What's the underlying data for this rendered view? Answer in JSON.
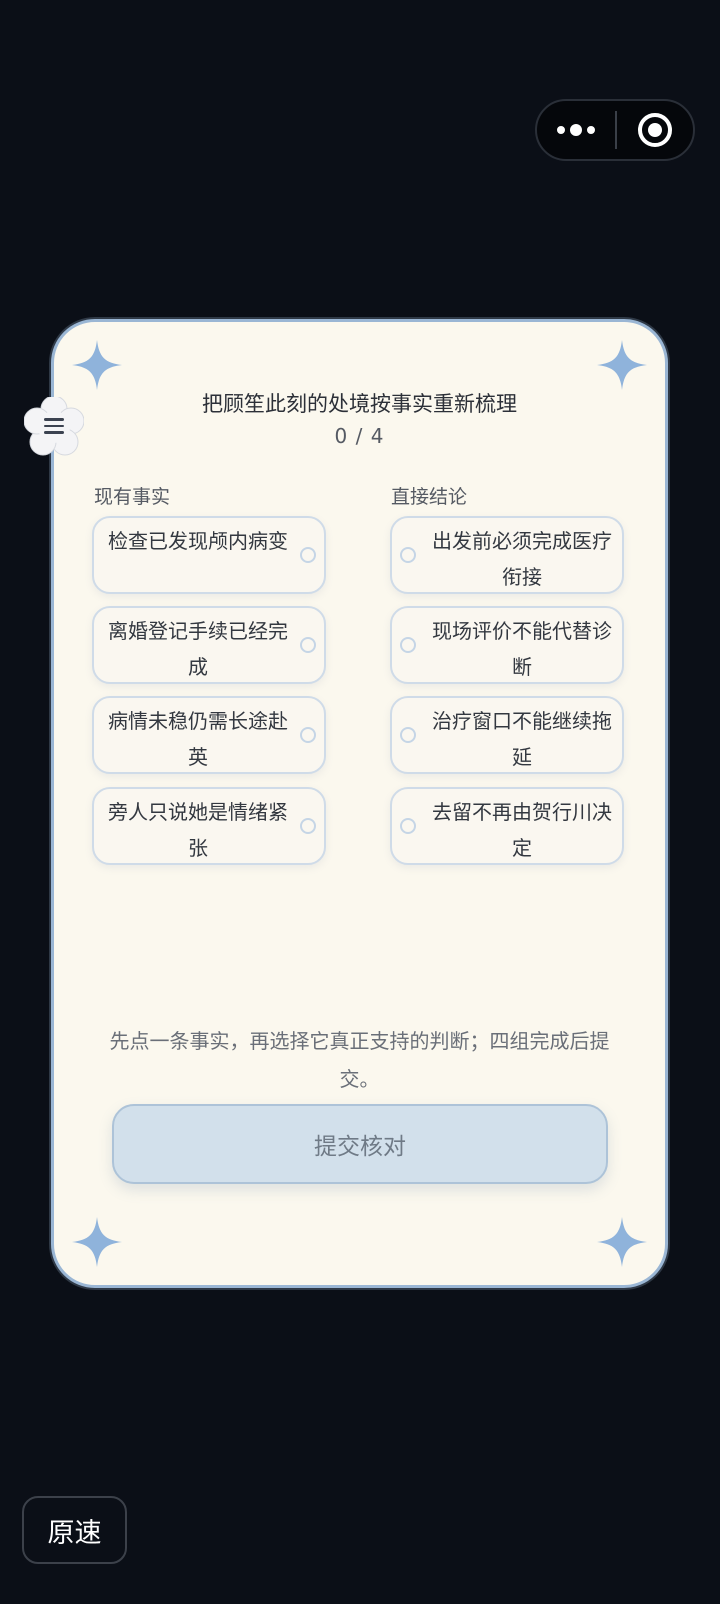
{
  "capsule": {
    "more_icon": "more-dots-icon",
    "close_icon": "target-close-icon"
  },
  "card": {
    "title": "把顾笙此刻的处境按事实重新梳理",
    "progress": "0 / 4",
    "left_label": "现有事实",
    "right_label": "直接结论",
    "facts": [
      "检查已发现颅内病变",
      "离婚登记手续已经完成",
      "病情未稳仍需长途赴英",
      "旁人只说她是情绪紧张"
    ],
    "conclusions": [
      "出发前必须完成医疗衔接",
      "现场评价不能代替诊断",
      "治疗窗口不能继续拖延",
      "去留不再由贺行川决定"
    ],
    "hint": "先点一条事实，再选择它真正支持的判断；四组完成后提交。",
    "submit_label": "提交核对",
    "accent_color": "#8fb3db",
    "card_bg": "#fbf8ee"
  },
  "floating_menu": {
    "icon": "menu-icon"
  },
  "speed_button": {
    "label": "原速"
  }
}
